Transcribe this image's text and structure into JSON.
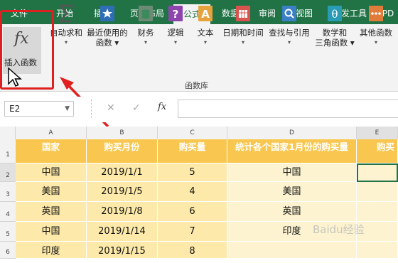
{
  "tabs": [
    "文件",
    "开始",
    "插入",
    "页面布局",
    "公式",
    "数据",
    "审阅",
    "视图",
    "开发工具",
    "PD"
  ],
  "active_tab": "公式",
  "ribbon": {
    "insert_function": {
      "glyph": "fx",
      "label": "插入函数"
    },
    "buttons": [
      {
        "line1": "自动求和",
        "line2": "▾",
        "icon": "sigma-icon",
        "color": "#555555"
      },
      {
        "line1": "最近使用的",
        "line2": "函数 ▾",
        "icon": "star-book-icon",
        "color": "#2f6db5"
      },
      {
        "line1": "财务",
        "line2": "▾",
        "icon": "money-book-icon",
        "color": "#3a8a5c"
      },
      {
        "line1": "逻辑",
        "line2": "▾",
        "icon": "question-book-icon",
        "color": "#8e44ad"
      },
      {
        "line1": "文本",
        "line2": "▾",
        "icon": "text-book-icon",
        "color": "#e6a23c"
      },
      {
        "line1": "日期和时间",
        "line2": "▾",
        "icon": "calendar-book-icon",
        "color": "#d9534f"
      },
      {
        "line1": "查找与引用",
        "line2": "▾",
        "icon": "search-book-icon",
        "color": "#3b7fc4"
      },
      {
        "line1": "数学和",
        "line2": "三角函数 ▾",
        "icon": "theta-book-icon",
        "color": "#2a9bb5"
      },
      {
        "line1": "其他函数",
        "line2": "▾",
        "icon": "more-book-icon",
        "color": "#e07b39"
      }
    ],
    "group_label": "函数库"
  },
  "formula_bar": {
    "name_box": "E2",
    "cancel_symbol": "✕",
    "confirm_symbol": "✓",
    "fx_symbol": "fx",
    "formula": ""
  },
  "grid": {
    "columns": [
      "A",
      "B",
      "C",
      "D",
      "E"
    ],
    "row_numbers": [
      "1",
      "2",
      "3",
      "4",
      "5",
      "6"
    ],
    "header_row": [
      "国家",
      "购买月份",
      "购买量",
      "统计各个国家1月份的购买量",
      "购买"
    ],
    "rows": [
      [
        "中国",
        "2019/1/1",
        "5",
        "中国",
        ""
      ],
      [
        "美国",
        "2019/1/5",
        "4",
        "美国",
        ""
      ],
      [
        "英国",
        "2019/1/8",
        "6",
        "英国",
        ""
      ],
      [
        "中国",
        "2019/1/14",
        "7",
        "印度",
        ""
      ],
      [
        "印度",
        "2019/1/15",
        "8",
        "",
        ""
      ]
    ]
  },
  "watermark": "Baidu经验",
  "colors": {
    "accent": "#217346",
    "header_fill": "#f9c74f",
    "data_fill": "#fde9a9",
    "highlight": "#e02020"
  }
}
